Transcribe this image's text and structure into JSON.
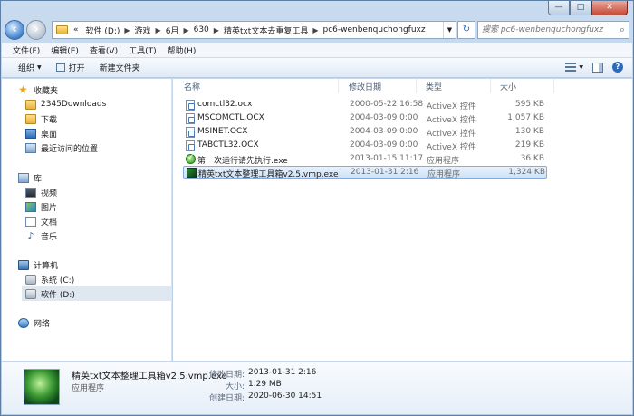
{
  "address": {
    "crumbs": [
      "«",
      "软件 (D:)",
      "游戏",
      "6月",
      "630",
      "精英txt文本去重复工具",
      "pc6-wenbenquchongfuxz"
    ],
    "search_placeholder": "搜索 pc6-wenbenquchongfuxz"
  },
  "menu": [
    "文件(F)",
    "编辑(E)",
    "查看(V)",
    "工具(T)",
    "帮助(H)"
  ],
  "toolbar": {
    "organize": "组织",
    "open": "打开",
    "new_folder": "新建文件夹",
    "help": "?"
  },
  "nav": {
    "favorites": "收藏夹",
    "fav_items": [
      "2345Downloads",
      "下载",
      "桌面",
      "最近访问的位置"
    ],
    "libraries": "库",
    "lib_items": [
      "视频",
      "图片",
      "文档",
      "音乐"
    ],
    "computer": "计算机",
    "drives": [
      "系统 (C:)",
      "软件 (D:)"
    ],
    "network": "网络"
  },
  "columns": {
    "name": "名称",
    "date": "修改日期",
    "type": "类型",
    "size": "大小"
  },
  "files": [
    {
      "name": "comctl32.ocx",
      "date": "2000-05-22 16:58",
      "type": "ActiveX 控件",
      "size": "595 KB"
    },
    {
      "name": "MSCOMCTL.OCX",
      "date": "2004-03-09 0:00",
      "type": "ActiveX 控件",
      "size": "1,057 KB"
    },
    {
      "name": "MSINET.OCX",
      "date": "2004-03-09 0:00",
      "type": "ActiveX 控件",
      "size": "130 KB"
    },
    {
      "name": "TABCTL32.OCX",
      "date": "2004-03-09 0:00",
      "type": "ActiveX 控件",
      "size": "219 KB"
    },
    {
      "name": "第一次运行请先执行.exe",
      "date": "2013-01-15 11:17",
      "type": "应用程序",
      "size": "36 KB"
    },
    {
      "name": "精英txt文本整理工具箱v2.5.vmp.exe",
      "date": "2013-01-31 2:16",
      "type": "应用程序",
      "size": "1,324 KB"
    }
  ],
  "details": {
    "name": "精英txt文本整理工具箱v2.5.vmp.exe",
    "type": "应用程序",
    "modified_label": "修改日期:",
    "modified": "2013-01-31 2:16",
    "size_label": "大小:",
    "size": "1.29 MB",
    "created_label": "创建日期:",
    "created": "2020-06-30 14:51"
  }
}
